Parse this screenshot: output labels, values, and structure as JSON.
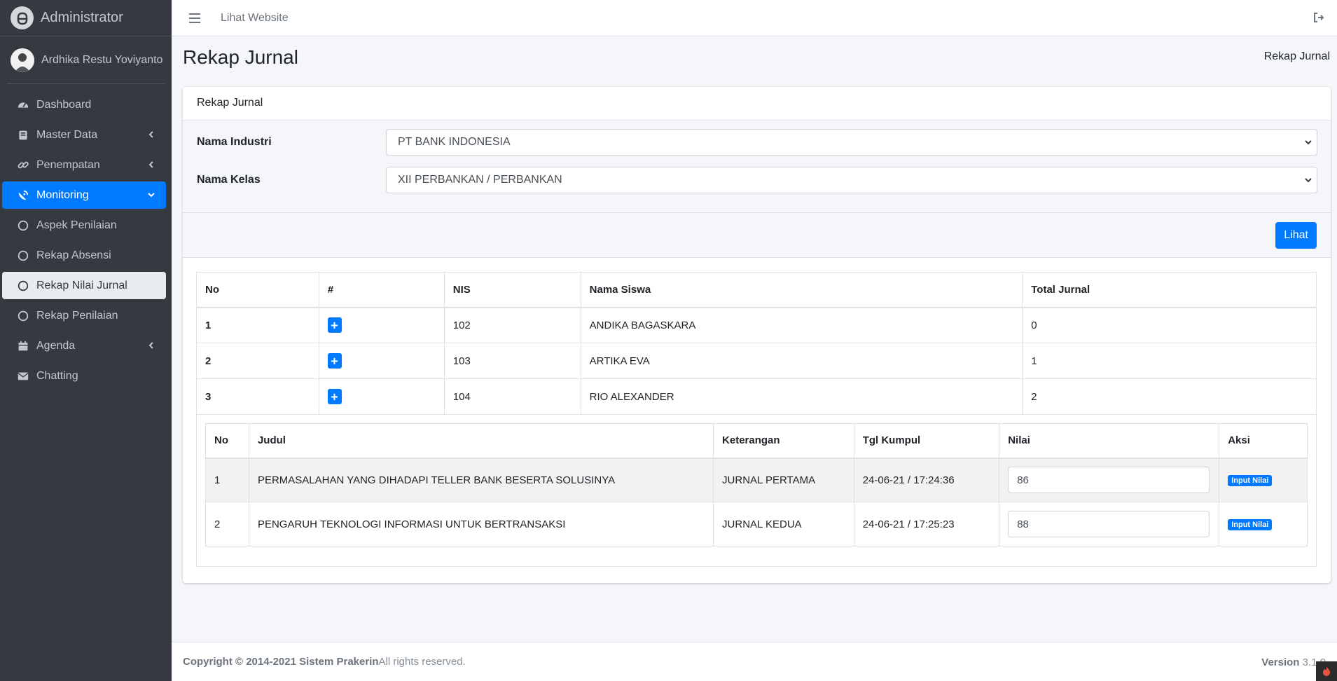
{
  "brand": {
    "title": "Administrator",
    "logo_icon": "brand-logo-icon"
  },
  "user": {
    "name": "Ardhika Restu Yoviyanto"
  },
  "sidebar": {
    "items": [
      {
        "label": "Dashboard",
        "icon": "tachometer-icon"
      },
      {
        "label": "Master Data",
        "icon": "book-icon"
      },
      {
        "label": "Penempatan",
        "icon": "link-icon"
      },
      {
        "label": "Monitoring",
        "icon": "satellite-dish-icon"
      },
      {
        "label": "Aspek Penilaian",
        "icon": "circle-icon"
      },
      {
        "label": "Rekap Absensi",
        "icon": "circle-icon"
      },
      {
        "label": "Rekap Nilai Jurnal",
        "icon": "circle-icon"
      },
      {
        "label": "Rekap Penilaian",
        "icon": "circle-icon"
      },
      {
        "label": "Agenda",
        "icon": "calendar-icon"
      },
      {
        "label": "Chatting",
        "icon": "envelope-icon"
      }
    ]
  },
  "topbar": {
    "link": "Lihat Website"
  },
  "page": {
    "title": "Rekap Jurnal",
    "breadcrumb": "Rekap Jurnal"
  },
  "card": {
    "header": "Rekap Jurnal",
    "industri_label": "Nama Industri",
    "industri_value": "PT BANK INDONESIA",
    "kelas_label": "Nama Kelas",
    "kelas_value": "XII PERBANKAN / PERBANKAN",
    "button": "Lihat"
  },
  "table": {
    "headers": [
      "No",
      "#",
      "NIS",
      "Nama Siswa",
      "Total Jurnal"
    ],
    "rows": [
      {
        "no": "1",
        "nis": "102",
        "nama": "ANDIKA BAGASKARA",
        "total": "0"
      },
      {
        "no": "2",
        "nis": "103",
        "nama": "ARTIKA EVA",
        "total": "1"
      },
      {
        "no": "3",
        "nis": "104",
        "nama": "RIO ALEXANDER",
        "total": "2"
      }
    ]
  },
  "detail": {
    "headers": [
      "No",
      "Judul",
      "Keterangan",
      "Tgl Kumpul",
      "Nilai",
      "Aksi"
    ],
    "rows": [
      {
        "no": "1",
        "judul": "PERMASALAHAN YANG DIHADAPI TELLER BANK BESERTA SOLUSINYA",
        "keterangan": "JURNAL PERTAMA",
        "tgl": "24-06-21 / 17:24:36",
        "nilai": "86",
        "aksi": "Input Nilai"
      },
      {
        "no": "2",
        "judul": "PENGARUH TEKNOLOGI INFORMASI UNTUK BERTRANSAKSI",
        "keterangan": "JURNAL KEDUA",
        "tgl": "24-06-21 / 17:25:23",
        "nilai": "88",
        "aksi": "Input Nilai"
      }
    ]
  },
  "footer": {
    "copyright": "Copyright © 2014-2021 Sistem Prakerin",
    "rights": " All rights reserved.",
    "version_label": "Version",
    "version_value": " 3.1.0"
  },
  "colors": {
    "primary": "#007bff",
    "sidebar": "#343a40",
    "background": "#f4f6f9"
  }
}
